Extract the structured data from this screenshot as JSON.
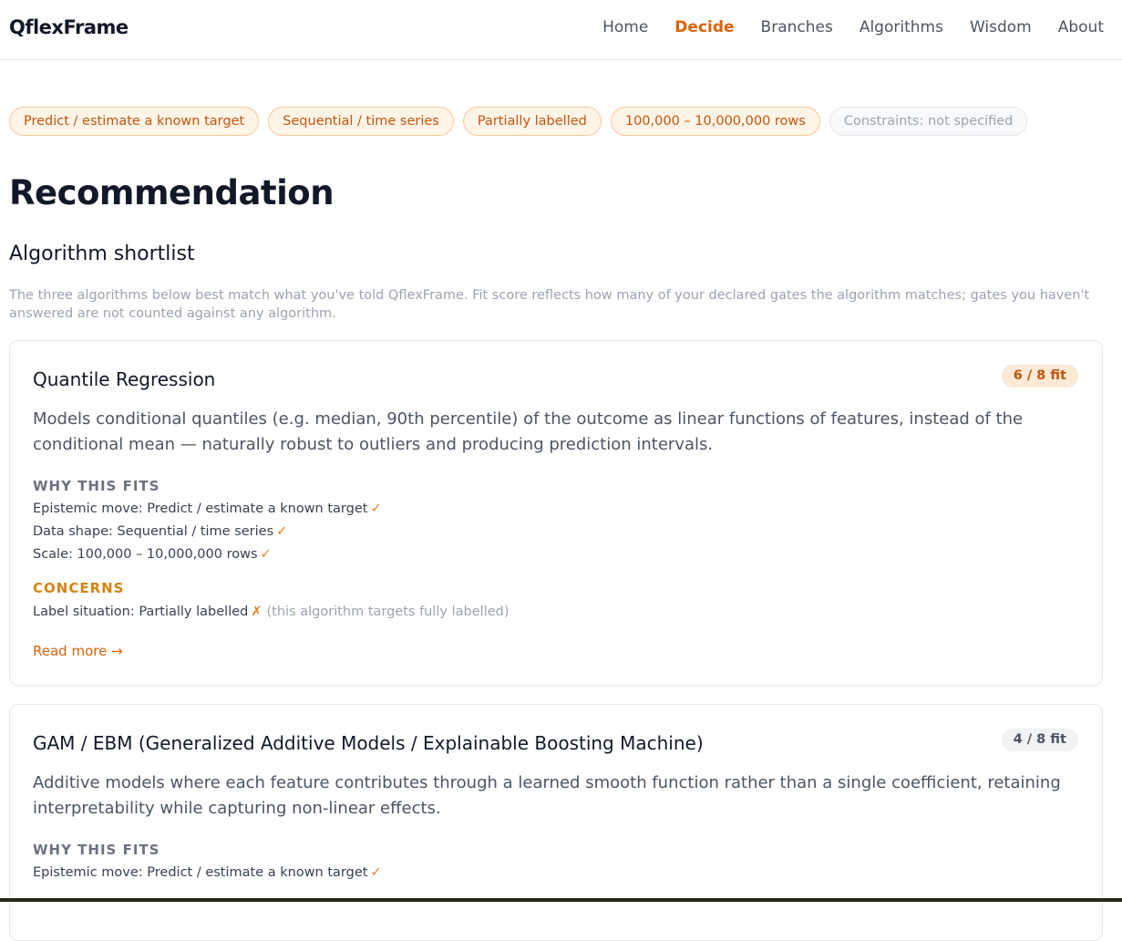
{
  "brand": "QflexFrame",
  "nav": {
    "home": "Home",
    "decide": "Decide",
    "branches": "Branches",
    "algorithms": "Algorithms",
    "wisdom": "Wisdom",
    "about": "About",
    "active": "Decide"
  },
  "chips": {
    "move": "Predict / estimate a known target",
    "shape": "Sequential / time series",
    "labels": "Partially labelled",
    "scale": "100,000 – 10,000,000 rows",
    "constraints": "Constraints: not specified"
  },
  "page_title": "Recommendation",
  "section": {
    "title": "Algorithm shortlist",
    "description": "The three algorithms below best match what you've told QflexFrame. Fit score reflects how many of your declared gates the algorithm matches; gates you haven't answered are not counted against any algorithm."
  },
  "cards": [
    {
      "title": "Quantile Regression",
      "fit": "6 / 8 fit",
      "description": "Models conditional quantiles (e.g. median, 90th percentile) of the outcome as linear functions of features, instead of the conditional mean — naturally robust to outliers and producing prediction intervals.",
      "why_label": "WHY THIS FITS",
      "why": [
        "Epistemic move: Predict / estimate a known target",
        "Data shape: Sequential / time series",
        "Scale: 100,000 – 10,000,000 rows"
      ],
      "concerns_label": "CONCERNS",
      "concerns": [
        {
          "text": "Label situation: Partially labelled",
          "note": "(this algorithm targets fully labelled)"
        }
      ],
      "read_more": "Read more →"
    },
    {
      "title": "GAM / EBM (Generalized Additive Models / Explainable Boosting Machine)",
      "fit": "4 / 8 fit",
      "description": "Additive models where each feature contributes through a learned smooth function rather than a single coefficient, retaining interpretability while capturing non-linear effects.",
      "why_label": "WHY THIS FITS",
      "why": [
        "Epistemic move: Predict / estimate a known target"
      ]
    }
  ],
  "marks": {
    "check": "✓",
    "cross": "✗"
  },
  "colors": {
    "accent": "#d9630b",
    "chip_bg": "#fff4e8",
    "chip_border": "#f7c89a",
    "concerns": "#d48311"
  }
}
